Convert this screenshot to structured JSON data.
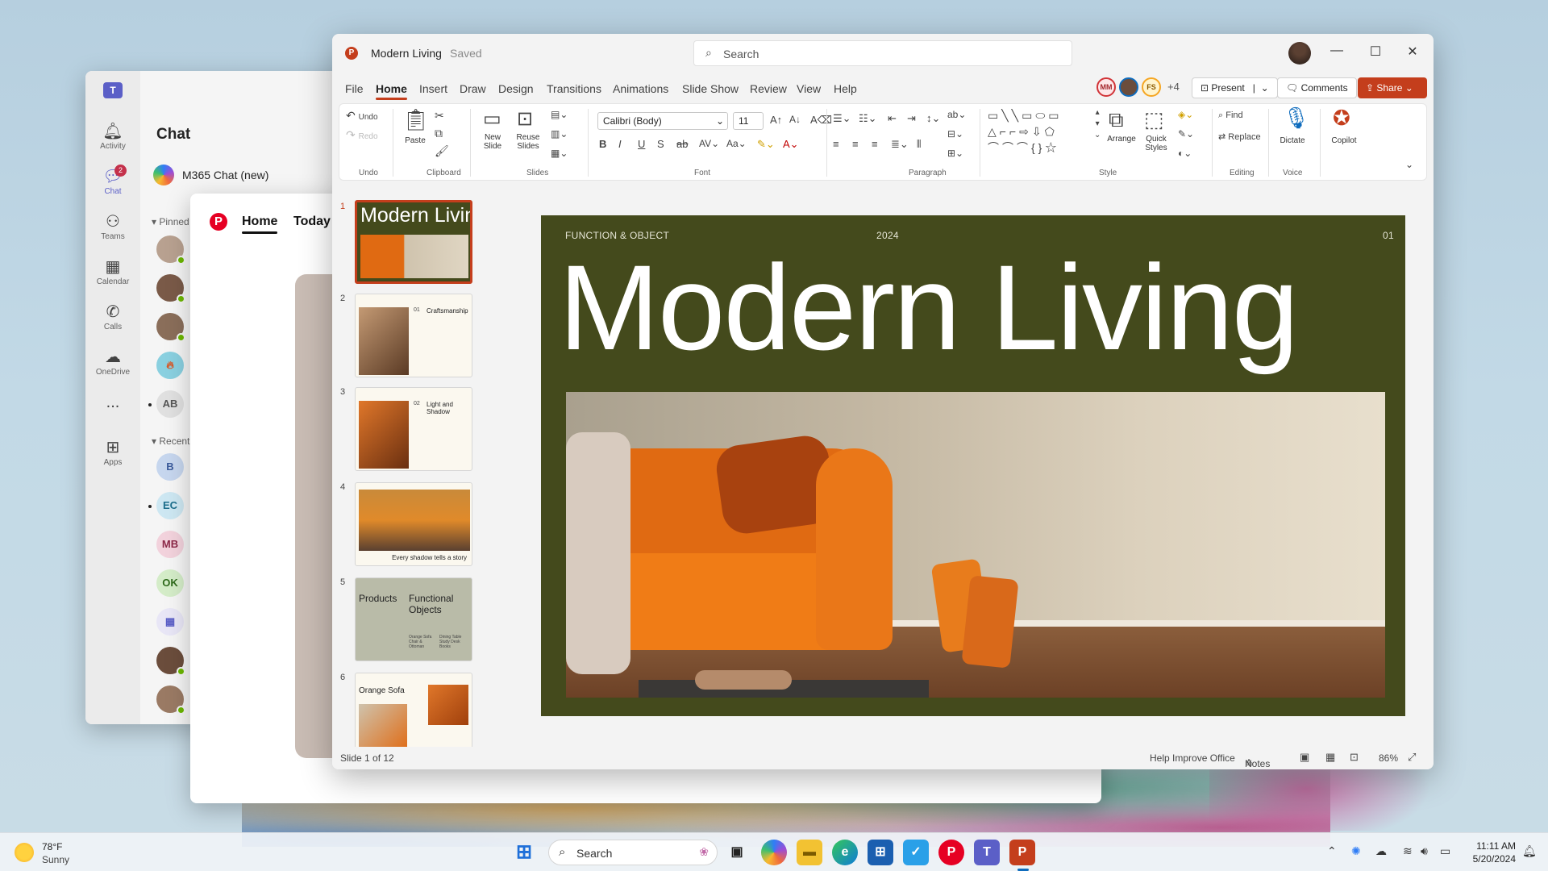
{
  "teams": {
    "rail": [
      {
        "label": "Activity",
        "icon": "bell-icon"
      },
      {
        "label": "Chat",
        "icon": "chat-icon",
        "badge": "2"
      },
      {
        "label": "Teams",
        "icon": "teams-icon"
      },
      {
        "label": "Calendar",
        "icon": "calendar-icon"
      },
      {
        "label": "Calls",
        "icon": "phone-icon"
      },
      {
        "label": "OneDrive",
        "icon": "cloud-icon"
      },
      {
        "label": "...",
        "icon": "more-icon"
      },
      {
        "label": "Apps",
        "icon": "apps-icon"
      }
    ],
    "title": "Chat",
    "copilot_chat": "M365 Chat (new)",
    "pinned_label": "Pinned",
    "recent_label": "Recent",
    "avatars": [
      "AB",
      "B",
      "EC",
      "MB",
      "OK"
    ]
  },
  "pinterest": {
    "tabs": [
      "Home",
      "Today"
    ]
  },
  "ppt": {
    "title": "Modern Living",
    "saved": "Saved",
    "search_placeholder": "Search",
    "menu": [
      "File",
      "Home",
      "Insert",
      "Draw",
      "Design",
      "Transitions",
      "Animations",
      "Slide Show",
      "Review",
      "View",
      "Help"
    ],
    "collaborators": [
      "MM",
      "FS"
    ],
    "more_collaborators": "+4",
    "present": "Present",
    "comments": "Comments",
    "share": "Share",
    "ribbon": {
      "undo": "Undo",
      "redo": "Redo",
      "paste": "Paste",
      "new_slide": "New Slide",
      "reuse_slides": "Reuse Slides",
      "font_name": "Calibri (Body)",
      "font_size": "11",
      "arrange": "Arrange",
      "quick_styles": "Quick Styles",
      "find": "Find",
      "replace": "Replace",
      "dictate": "Dictate",
      "copilot": "Copilot",
      "groups": [
        "Undo",
        "Clipboard",
        "Slides",
        "Font",
        "Paragraph",
        "Style",
        "Editing",
        "Voice"
      ]
    },
    "thumbnails": [
      {
        "num": "1",
        "title": "Modern Living"
      },
      {
        "num": "2",
        "title": "Craftsmanship",
        "index": "01"
      },
      {
        "num": "3",
        "title": "Light and Shadow",
        "index": "02"
      },
      {
        "num": "4",
        "title": "Every shadow tells a story"
      },
      {
        "num": "5",
        "title": "Products",
        "subtitle": "Functional Objects",
        "col1": "Orange Sofa Chair & Ottoman",
        "col2": "Dining Table Study Desk Books"
      },
      {
        "num": "6",
        "title": "Orange Sofa"
      }
    ],
    "slide": {
      "meta_left": "FUNCTION & OBJECT",
      "meta_year": "2024",
      "meta_page": "01",
      "title": "Modern Living"
    },
    "status": {
      "slide_count": "Slide 1 of 12",
      "help": "Help Improve Office",
      "notes": "Notes",
      "zoom": "86%"
    }
  },
  "taskbar": {
    "temp": "78°F",
    "weather": "Sunny",
    "search": "Search",
    "time": "11:11 AM",
    "date": "5/20/2024"
  }
}
